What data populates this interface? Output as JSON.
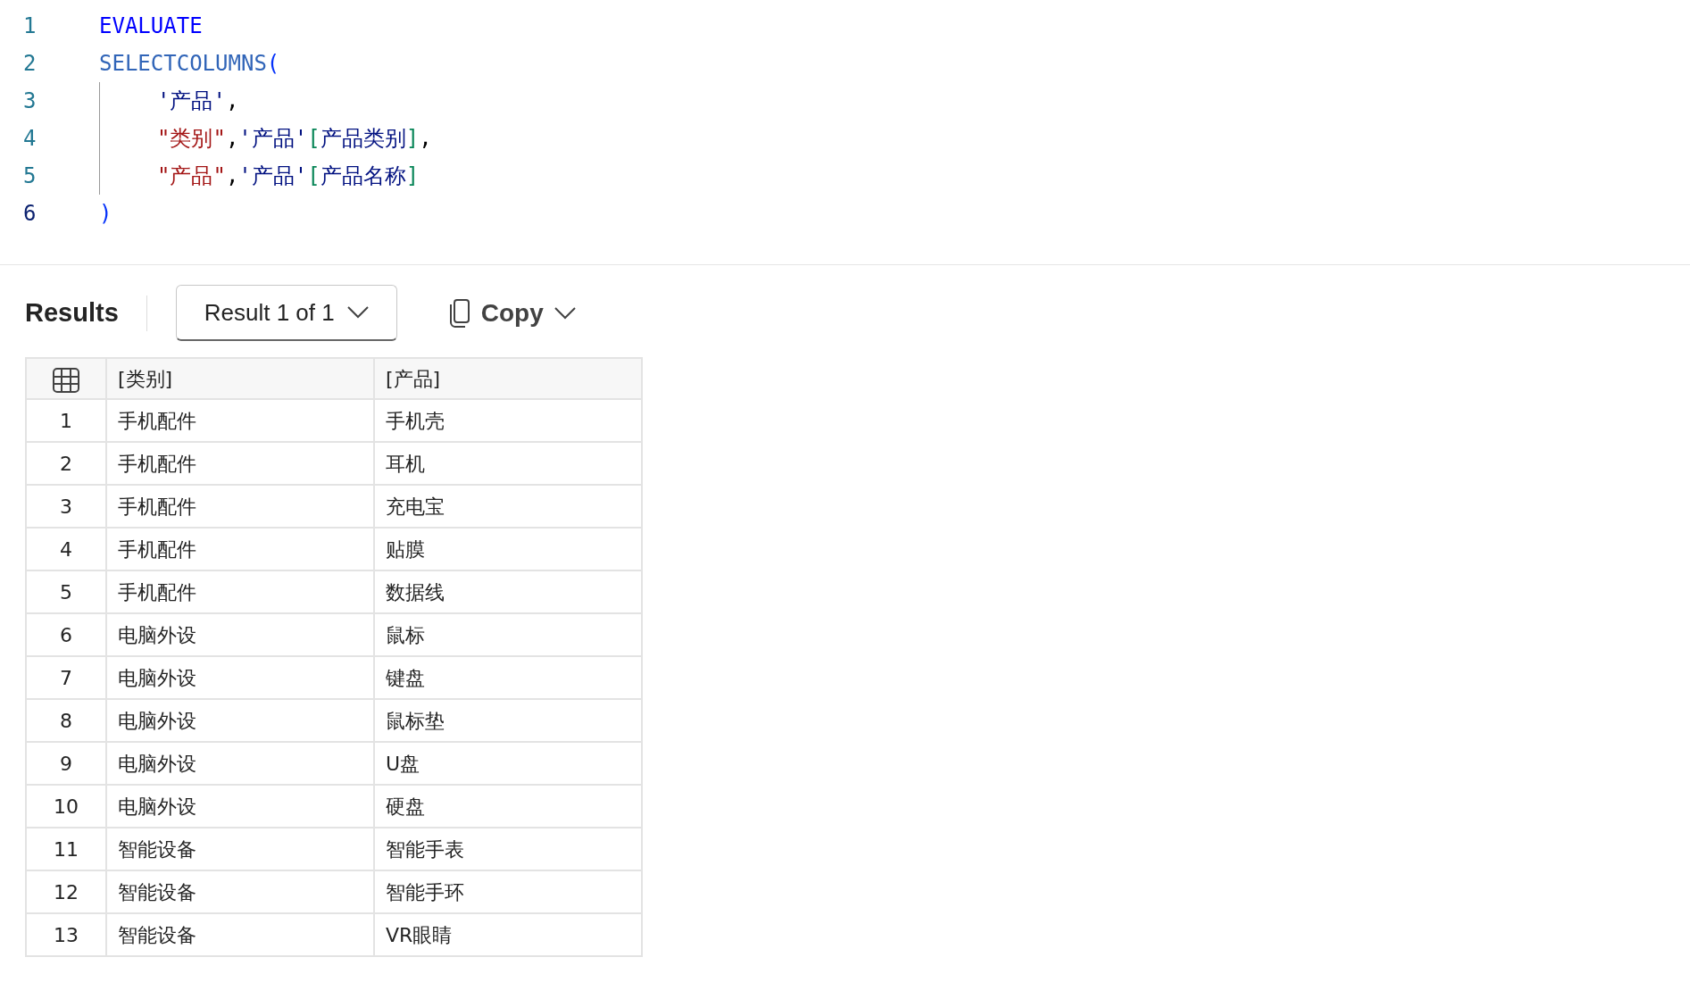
{
  "editor": {
    "lines": [
      {
        "number": "1",
        "indented": false,
        "tokens": [
          {
            "kind": "keyword",
            "text": "EVALUATE"
          }
        ]
      },
      {
        "number": "2",
        "indented": false,
        "tokens": [
          {
            "kind": "function",
            "text": "SELECTCOLUMNS"
          },
          {
            "kind": "paren",
            "text": "("
          }
        ]
      },
      {
        "number": "3",
        "indented": true,
        "tokens": [
          {
            "kind": "table",
            "text": "'产品'"
          },
          {
            "kind": "punct",
            "text": ","
          }
        ]
      },
      {
        "number": "4",
        "indented": true,
        "tokens": [
          {
            "kind": "string",
            "text": "\"类别\""
          },
          {
            "kind": "punct",
            "text": ","
          },
          {
            "kind": "table",
            "text": "'产品'"
          },
          {
            "kind": "bracket",
            "text": "["
          },
          {
            "kind": "table",
            "text": "产品类别"
          },
          {
            "kind": "bracket",
            "text": "]"
          },
          {
            "kind": "punct",
            "text": ","
          }
        ]
      },
      {
        "number": "5",
        "indented": true,
        "tokens": [
          {
            "kind": "string",
            "text": "\"产品\""
          },
          {
            "kind": "punct",
            "text": ","
          },
          {
            "kind": "table",
            "text": "'产品'"
          },
          {
            "kind": "bracket",
            "text": "["
          },
          {
            "kind": "table",
            "text": "产品名称"
          },
          {
            "kind": "bracket",
            "text": "]"
          }
        ]
      },
      {
        "number": "6",
        "indented": false,
        "tokens": [
          {
            "kind": "paren",
            "text": ")"
          }
        ]
      }
    ]
  },
  "results": {
    "title": "Results",
    "result_selector": "Result 1 of 1",
    "copy_label": "Copy",
    "table": {
      "columns": [
        "[类别]",
        "[产品]"
      ],
      "rows": [
        {
          "index": "1",
          "cells": [
            "手机配件",
            "手机壳"
          ]
        },
        {
          "index": "2",
          "cells": [
            "手机配件",
            "耳机"
          ]
        },
        {
          "index": "3",
          "cells": [
            "手机配件",
            "充电宝"
          ]
        },
        {
          "index": "4",
          "cells": [
            "手机配件",
            "贴膜"
          ]
        },
        {
          "index": "5",
          "cells": [
            "手机配件",
            "数据线"
          ]
        },
        {
          "index": "6",
          "cells": [
            "电脑外设",
            "鼠标"
          ]
        },
        {
          "index": "7",
          "cells": [
            "电脑外设",
            "键盘"
          ]
        },
        {
          "index": "8",
          "cells": [
            "电脑外设",
            "鼠标垫"
          ]
        },
        {
          "index": "9",
          "cells": [
            "电脑外设",
            "U盘"
          ]
        },
        {
          "index": "10",
          "cells": [
            "电脑外设",
            "硬盘"
          ]
        },
        {
          "index": "11",
          "cells": [
            "智能设备",
            "智能手表"
          ]
        },
        {
          "index": "12",
          "cells": [
            "智能设备",
            "智能手环"
          ]
        },
        {
          "index": "13",
          "cells": [
            "智能设备",
            "VR眼睛"
          ]
        }
      ]
    }
  }
}
